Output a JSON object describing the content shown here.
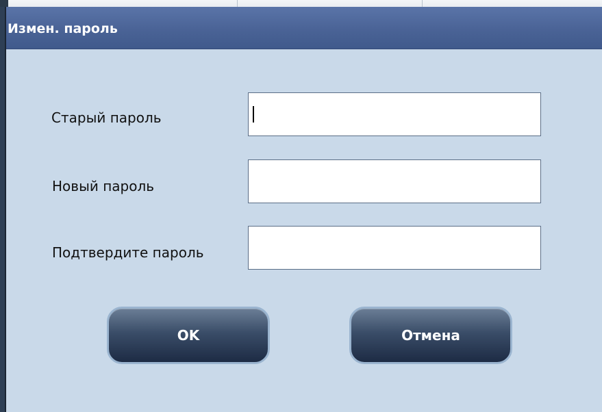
{
  "dialog": {
    "title": "Измен. пароль"
  },
  "fields": {
    "old_password": {
      "label": "Старый пароль",
      "value": ""
    },
    "new_password": {
      "label": "Новый пароль",
      "value": ""
    },
    "confirm_password": {
      "label": "Подтвердите пароль",
      "value": ""
    }
  },
  "buttons": {
    "ok": "OK",
    "cancel": "Отмена"
  },
  "colors": {
    "titlebar": "#4a6396",
    "dialog_background": "#c9d9e9",
    "button_dark": "#1d2b44",
    "button_border": "#9ab4cf"
  }
}
